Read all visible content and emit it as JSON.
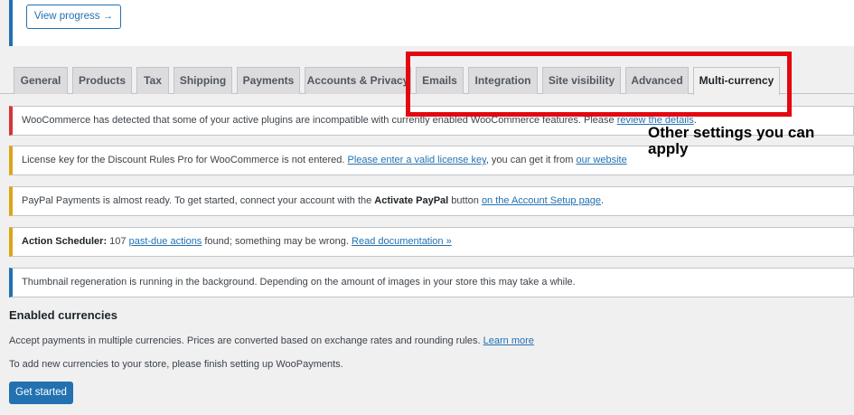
{
  "progress": {
    "button_label": "View progress →"
  },
  "tabs": [
    {
      "label": "General",
      "active": false
    },
    {
      "label": "Products",
      "active": false
    },
    {
      "label": "Tax",
      "active": false
    },
    {
      "label": "Shipping",
      "active": false
    },
    {
      "label": "Payments",
      "active": false
    },
    {
      "label": "Accounts & Privacy",
      "active": false
    },
    {
      "label": "Emails",
      "active": false
    },
    {
      "label": "Integration",
      "active": false
    },
    {
      "label": "Site visibility",
      "active": false
    },
    {
      "label": "Advanced",
      "active": false
    },
    {
      "label": "Multi-currency",
      "active": true
    }
  ],
  "annotation": {
    "callout_text": "Other settings you can apply",
    "highlight_color": "#e3070f"
  },
  "notices": {
    "incompatible": {
      "text": "WooCommerce has detected that some of your active plugins are incompatible with currently enabled WooCommerce features. Please ",
      "link": "review the details",
      "text_after": "."
    },
    "license": {
      "text": "License key for the Discount Rules Pro for WooCommerce is not entered. ",
      "link1": "Please enter a valid license key",
      "text_mid": ", you can get it from ",
      "link2": "our website"
    },
    "paypal": {
      "text": "PayPal Payments is almost ready. To get started, connect your account with the ",
      "bold": "Activate PayPal",
      "text_mid": " button ",
      "link": "on the Account Setup page",
      "text_after": "."
    },
    "scheduler": {
      "bold": "Action Scheduler:",
      "text": " 107 ",
      "link1": "past-due actions",
      "text_mid": " found; something may be wrong. ",
      "link2": "Read documentation »"
    },
    "thumbnail": {
      "text": "Thumbnail regeneration is running in the background. Depending on the amount of images in your store this may take a while."
    }
  },
  "currencies": {
    "title": "Enabled currencies",
    "description": "Accept payments in multiple currencies. Prices are converted based on exchange rates and rounding rules. ",
    "learn_more": "Learn more",
    "setup_text": "To add new currencies to your store, please finish setting up WooPayments.",
    "button_label": "Get started"
  },
  "colors": {
    "accent": "#2271b1",
    "error": "#d63638",
    "warning": "#dba617"
  }
}
